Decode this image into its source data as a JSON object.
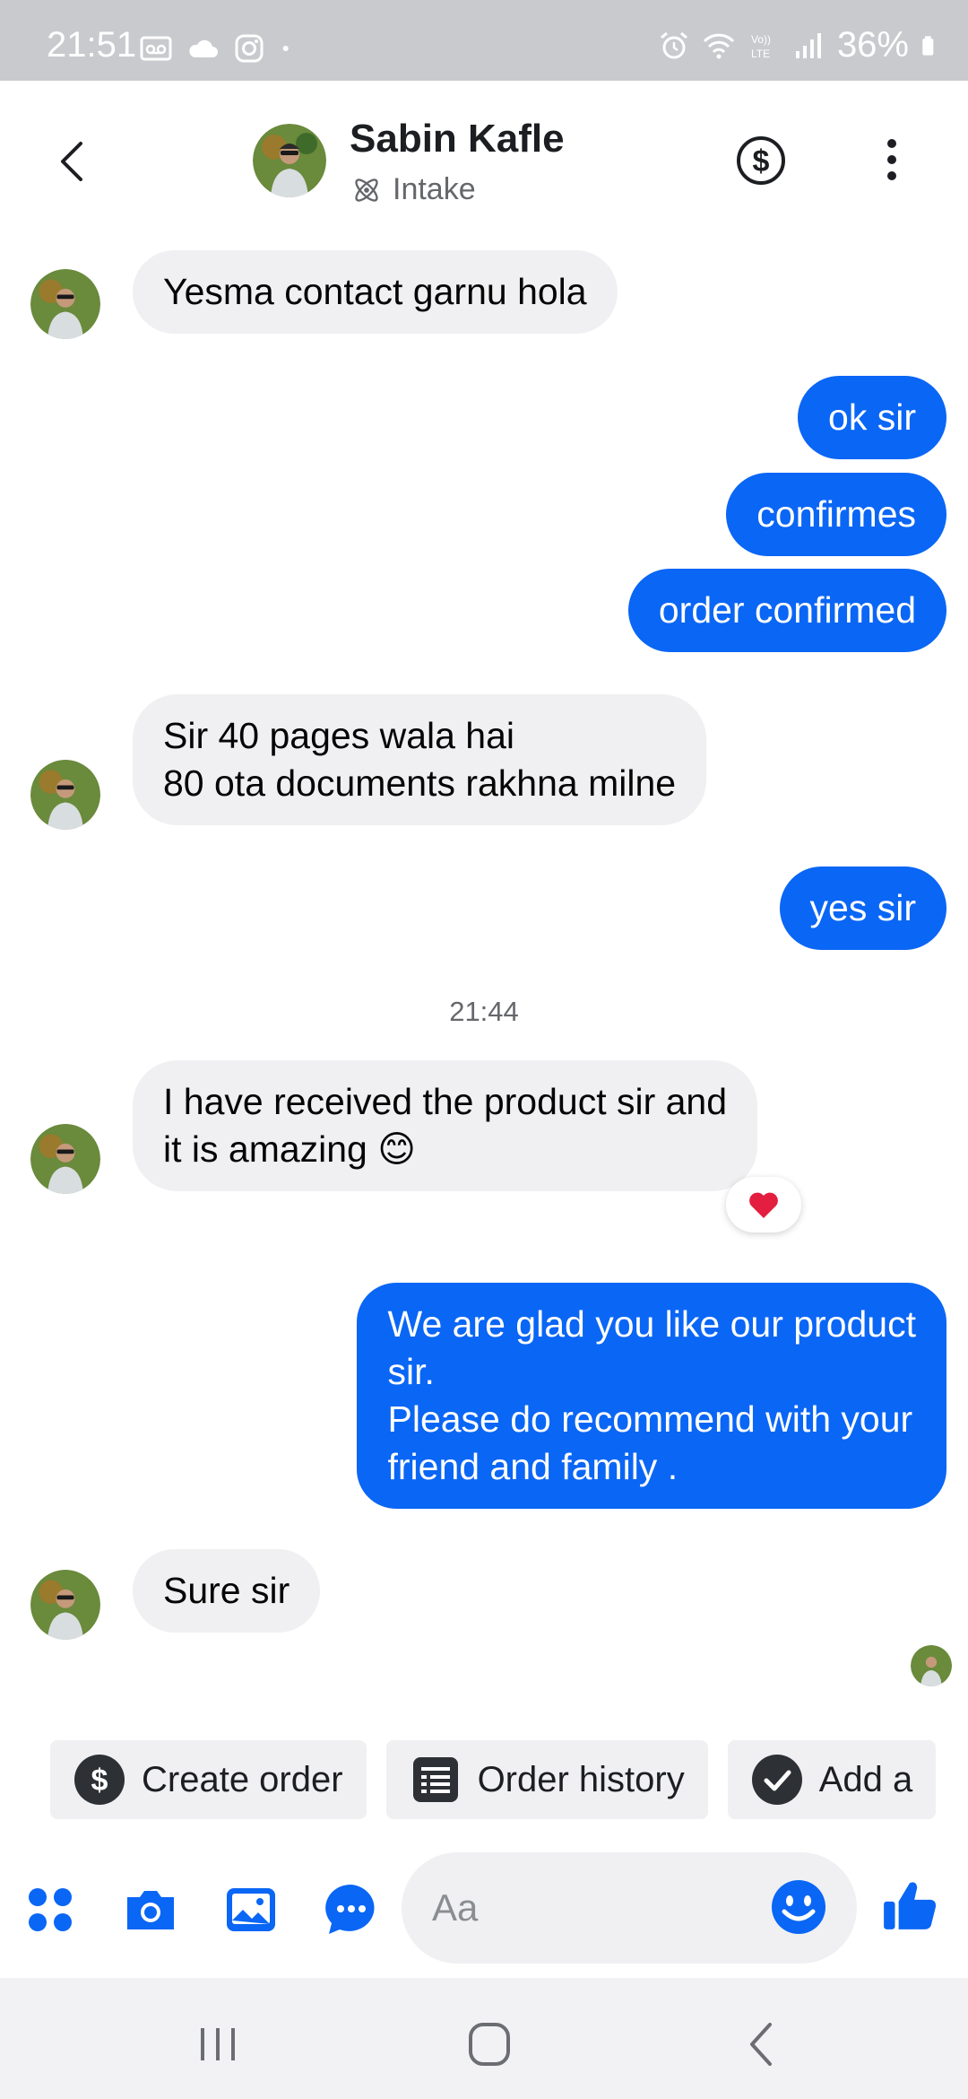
{
  "status_bar": {
    "time": "21:51",
    "battery": "36%",
    "left_icons": [
      "voicemail-icon",
      "cloud-icon",
      "instagram-icon",
      "dot-icon"
    ],
    "right_icons": [
      "alarm-icon",
      "wifi-icon",
      "volte-icon",
      "signal-icon",
      "battery-icon"
    ]
  },
  "header": {
    "name": "Sabin Kafle",
    "subtitle": "Intake",
    "back_icon": "chevron-left-icon",
    "payment_icon": "dollar-circle-icon",
    "more_icon": "more-vertical-icon"
  },
  "messages": [
    {
      "direction": "incoming",
      "lines": [
        "Yesma contact garnu hola"
      ]
    },
    {
      "direction": "outgoing",
      "lines": [
        "ok sir"
      ]
    },
    {
      "direction": "outgoing",
      "lines": [
        "confirmes"
      ]
    },
    {
      "direction": "outgoing",
      "lines": [
        "order confirmed"
      ]
    },
    {
      "direction": "incoming",
      "lines": [
        "Sir 40 pages wala hai",
        "80 ota documents rakhna milne"
      ]
    },
    {
      "direction": "outgoing",
      "lines": [
        "yes sir"
      ]
    },
    {
      "direction": "incoming",
      "lines": [
        "I have received the product sir and",
        "it is amazing 😊"
      ],
      "reaction": "heart-icon"
    },
    {
      "direction": "outgoing",
      "lines": [
        "We are glad you like our product",
        "sir.",
        "Please do recommend with your",
        "friend and family ."
      ]
    },
    {
      "direction": "incoming",
      "lines": [
        "Sure sir"
      ]
    }
  ],
  "timestamp": "21:44",
  "quick_actions": [
    {
      "label": "Create order",
      "icon": "dollar-circle-icon"
    },
    {
      "label": "Order history",
      "icon": "receipt-icon"
    },
    {
      "label": "Add a",
      "icon": "check-circle-icon"
    }
  ],
  "composer": {
    "placeholder": "Aa",
    "icons": [
      "apps-icon",
      "camera-icon",
      "gallery-icon",
      "chat-bubble-icon",
      "emoji-icon",
      "thumbs-up-icon"
    ]
  },
  "colors": {
    "accent": "#0a66f5",
    "incoming_bubble": "#f0f0f2",
    "outgoing_bubble": "#0a66f5",
    "status_bar": "#c9cacd"
  }
}
